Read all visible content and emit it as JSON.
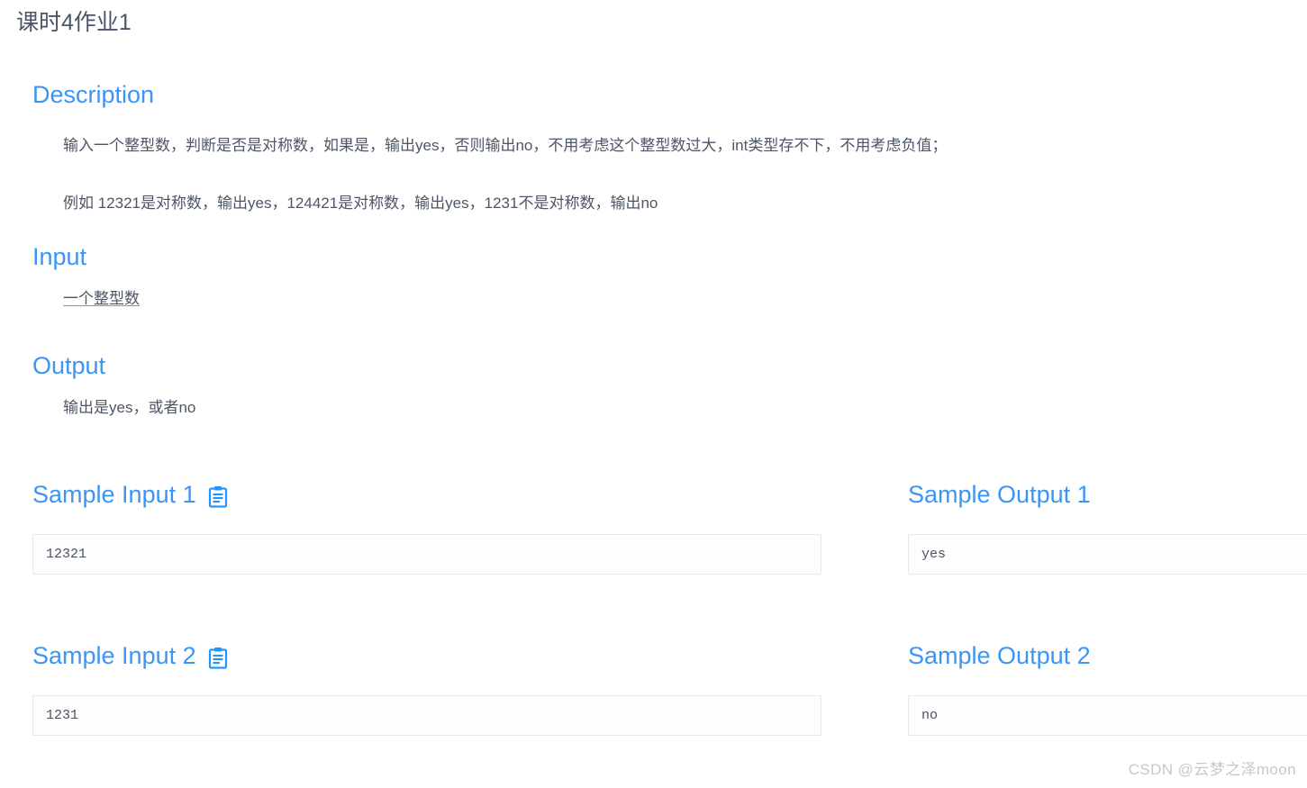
{
  "page": {
    "title": "课时4作业1",
    "accent_color": "#3b95f5",
    "text_color": "#4d5666",
    "background": "#ffffff"
  },
  "sections": {
    "description": {
      "heading": "Description",
      "line1": "输入一个整型数，判断是否是对称数，如果是，输出yes，否则输出no，不用考虑这个整型数过大，int类型存不下，不用考虑负值；",
      "line2": "例如 12321是对称数，输出yes，124421是对称数，输出yes，1231不是对称数，输出no"
    },
    "input": {
      "heading": "Input",
      "body": "一个整型数"
    },
    "output": {
      "heading": "Output",
      "body": "输出是yes，或者no"
    }
  },
  "samples": [
    {
      "input_heading": "Sample Input 1",
      "input_value": "12321",
      "input_copy_icon": "clipboard-copy-icon",
      "output_heading": "Sample Output 1",
      "output_value": "yes"
    },
    {
      "input_heading": "Sample Input 2",
      "input_value": "1231",
      "input_copy_icon": "clipboard-copy-icon",
      "output_heading": "Sample Output 2",
      "output_value": "no"
    }
  ],
  "watermark": {
    "text": "CSDN @云梦之泽moon"
  }
}
